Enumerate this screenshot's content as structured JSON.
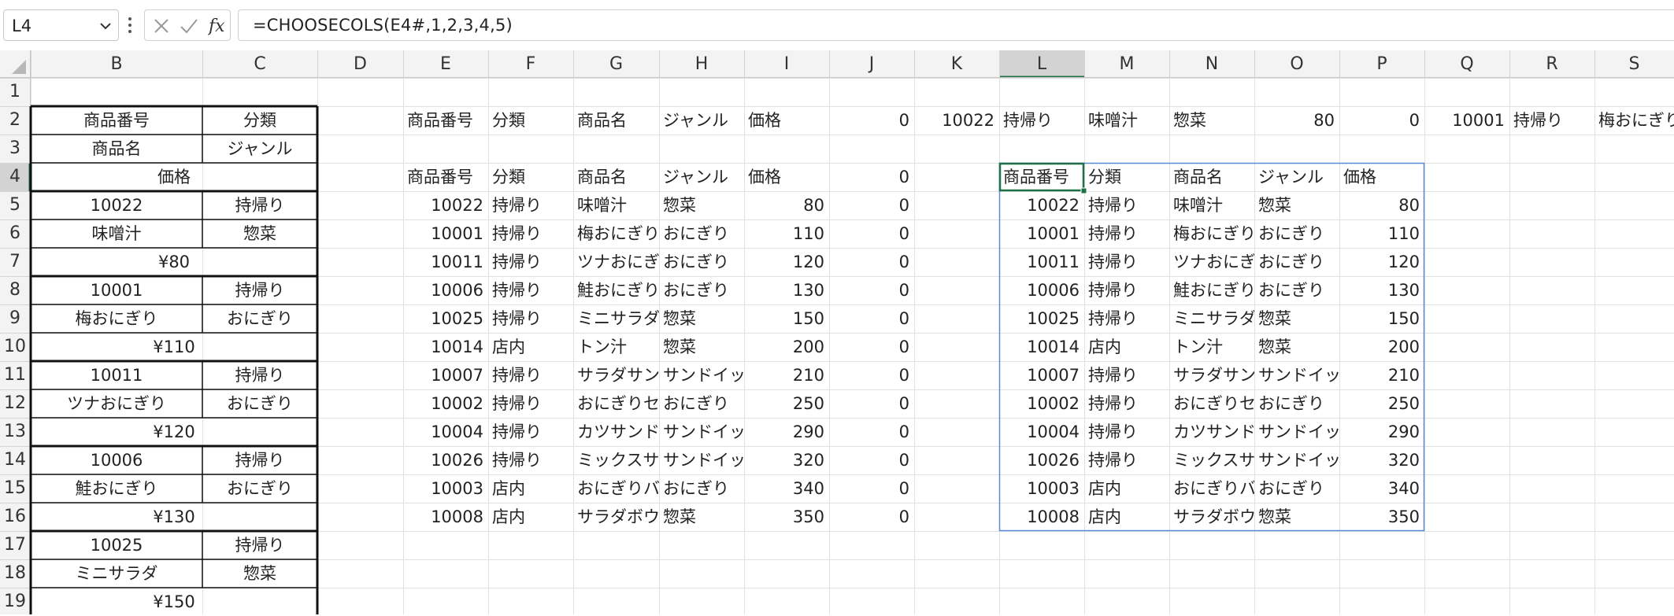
{
  "formula_bar": {
    "name_box": "L4",
    "formula": "=CHOOSECOLS(E4#,1,2,3,4,5)",
    "cancel_icon": "cancel-x-icon",
    "enter_icon": "check-icon",
    "function_icon": "fx-icon"
  },
  "sheet": {
    "columns": [
      "",
      "B",
      "C",
      "D",
      "E",
      "F",
      "G",
      "H",
      "I",
      "J",
      "K",
      "L",
      "M",
      "N",
      "O",
      "P",
      "Q",
      "R",
      "S"
    ],
    "rows": [
      "1",
      "2",
      "3",
      "4",
      "5",
      "6",
      "7",
      "8",
      "9",
      "10",
      "11",
      "12",
      "13",
      "14",
      "15",
      "16",
      "17",
      "18",
      "19"
    ],
    "selected_column": "L",
    "selected_row": "4",
    "colors": {
      "header_bg": "#f3f3f3",
      "selected_header_bg": "#d3d3d3",
      "gridline": "#e1e1e1",
      "active_cell_border": "#1f7145",
      "spill_range_border": "#5b8ad6"
    }
  },
  "card": [
    {
      "code": "",
      "cat": "",
      "name": "",
      "genre": "",
      "price": ""
    },
    {
      "code": "商品番号",
      "cat": "分類",
      "name": "商品名",
      "genre": "ジャンル",
      "price": "価格"
    },
    {
      "code": "10022",
      "cat": "持帰り",
      "name": "味噌汁",
      "genre": "惣菜",
      "price": "¥80"
    },
    {
      "code": "10001",
      "cat": "持帰り",
      "name": "梅おにぎり",
      "genre": "おにぎり",
      "price": "¥110"
    },
    {
      "code": "10011",
      "cat": "持帰り",
      "name": "ツナおにぎり",
      "genre": "おにぎり",
      "price": "¥120"
    },
    {
      "code": "10006",
      "cat": "持帰り",
      "name": "鮭おにぎり",
      "genre": "おにぎり",
      "price": "¥130"
    },
    {
      "code": "10025",
      "cat": "持帰り",
      "name": "ミニサラダ",
      "genre": "惣菜",
      "price": "¥150"
    }
  ],
  "row2": {
    "E": "商品番号",
    "F": "分類",
    "G": "商品名",
    "H": "ジャンル",
    "I": "価格",
    "J": "0",
    "K": "10022",
    "L": "持帰り",
    "M": "味噌汁",
    "N": "惣菜",
    "O": "80",
    "P": "0",
    "Q": "10001",
    "R": "持帰り",
    "S": "梅おにぎり"
  },
  "header4": {
    "E": "商品番号",
    "F": "分類",
    "G": "商品名",
    "H": "ジャンル",
    "I": "価格",
    "J": "0"
  },
  "table_rows": [
    {
      "code": "10022",
      "cat": "持帰り",
      "name": "味噌汁",
      "genre": "惣菜",
      "price": "80",
      "j": "0"
    },
    {
      "code": "10001",
      "cat": "持帰り",
      "name": "梅おにぎり",
      "genre": "おにぎり",
      "price": "110",
      "j": "0"
    },
    {
      "code": "10011",
      "cat": "持帰り",
      "name": "ツナおにぎり",
      "genre": "おにぎり",
      "price": "120",
      "j": "0"
    },
    {
      "code": "10006",
      "cat": "持帰り",
      "name": "鮭おにぎり",
      "genre": "おにぎり",
      "price": "130",
      "j": "0"
    },
    {
      "code": "10025",
      "cat": "持帰り",
      "name": "ミニサラダ",
      "genre": "惣菜",
      "price": "150",
      "j": "0"
    },
    {
      "code": "10014",
      "cat": "店内",
      "name": "トン汁",
      "genre": "惣菜",
      "price": "200",
      "j": "0"
    },
    {
      "code": "10007",
      "cat": "持帰り",
      "name": "サラダサンド",
      "genre": "サンドイッチ",
      "price": "210",
      "j": "0"
    },
    {
      "code": "10002",
      "cat": "持帰り",
      "name": "おにぎりセット",
      "genre": "おにぎり",
      "price": "250",
      "j": "0"
    },
    {
      "code": "10004",
      "cat": "持帰り",
      "name": "カツサンド",
      "genre": "サンドイッチ",
      "price": "290",
      "j": "0"
    },
    {
      "code": "10026",
      "cat": "持帰り",
      "name": "ミックスサンド",
      "genre": "サンドイッチ",
      "price": "320",
      "j": "0"
    },
    {
      "code": "10003",
      "cat": "店内",
      "name": "おにぎりバー",
      "genre": "おにぎり",
      "price": "340",
      "j": "0"
    },
    {
      "code": "10008",
      "cat": "店内",
      "name": "サラダボウル",
      "genre": "惣菜",
      "price": "350",
      "j": "0"
    }
  ],
  "spill_header": {
    "L": "商品番号",
    "M": "分類",
    "N": "商品名",
    "O": "ジャンル",
    "P": "価格"
  }
}
